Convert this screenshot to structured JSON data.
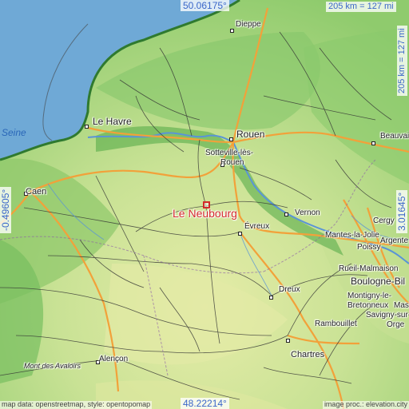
{
  "coords": {
    "top": "50.06175°",
    "bottom": "48.22214°",
    "left": "-0.49605°",
    "right": "3.01645°"
  },
  "scale": {
    "top": "205 km = 127 mi",
    "right": "205 km = 127 mi"
  },
  "attribution": {
    "left": "map data: openstreetmap, style: opentopomap",
    "right": "image proc.: elevation.city"
  },
  "marker": {
    "name": "Le Neubourg"
  },
  "labels": {
    "seine": "Seine",
    "le_havre": "Le Havre",
    "rouen": "Rouen",
    "sotteville": "Sotteville-lès-",
    "sotteville2": "Rouen",
    "dieppe": "Dieppe",
    "beauvais": "Beauvai",
    "caen": "Caen",
    "evreux": "Évreux",
    "vernon": "Vernon",
    "cergy": "Cergy",
    "mantes": "Mantes-la-Jolie",
    "argenteuil": "Argente",
    "poissy": "Poissy",
    "rueil": "Rueil-Malmaison",
    "boulogne": "Boulogne-Bil",
    "montigny1": "Montigny-le-",
    "montigny2": "Bretonneux",
    "massy": "Mass",
    "savigny": "Savigny-sur-",
    "orge": "Orge",
    "dreux": "Dreux",
    "rambouillet": "Rambouillet",
    "chartres": "Chartres",
    "alencon": "Alençon",
    "mont_avaloirs": "Mont des Avaloirs"
  },
  "colors": {
    "sea": "#6fa9d6",
    "lowland": "#9fd27a",
    "plain": "#c2e08f",
    "plateau": "#dce9a2",
    "highland": "#6cbb5e",
    "motorway": "#f2a13a",
    "road": "#333333",
    "marker": "#d32a2a",
    "coord_text": "#3b67c9"
  }
}
